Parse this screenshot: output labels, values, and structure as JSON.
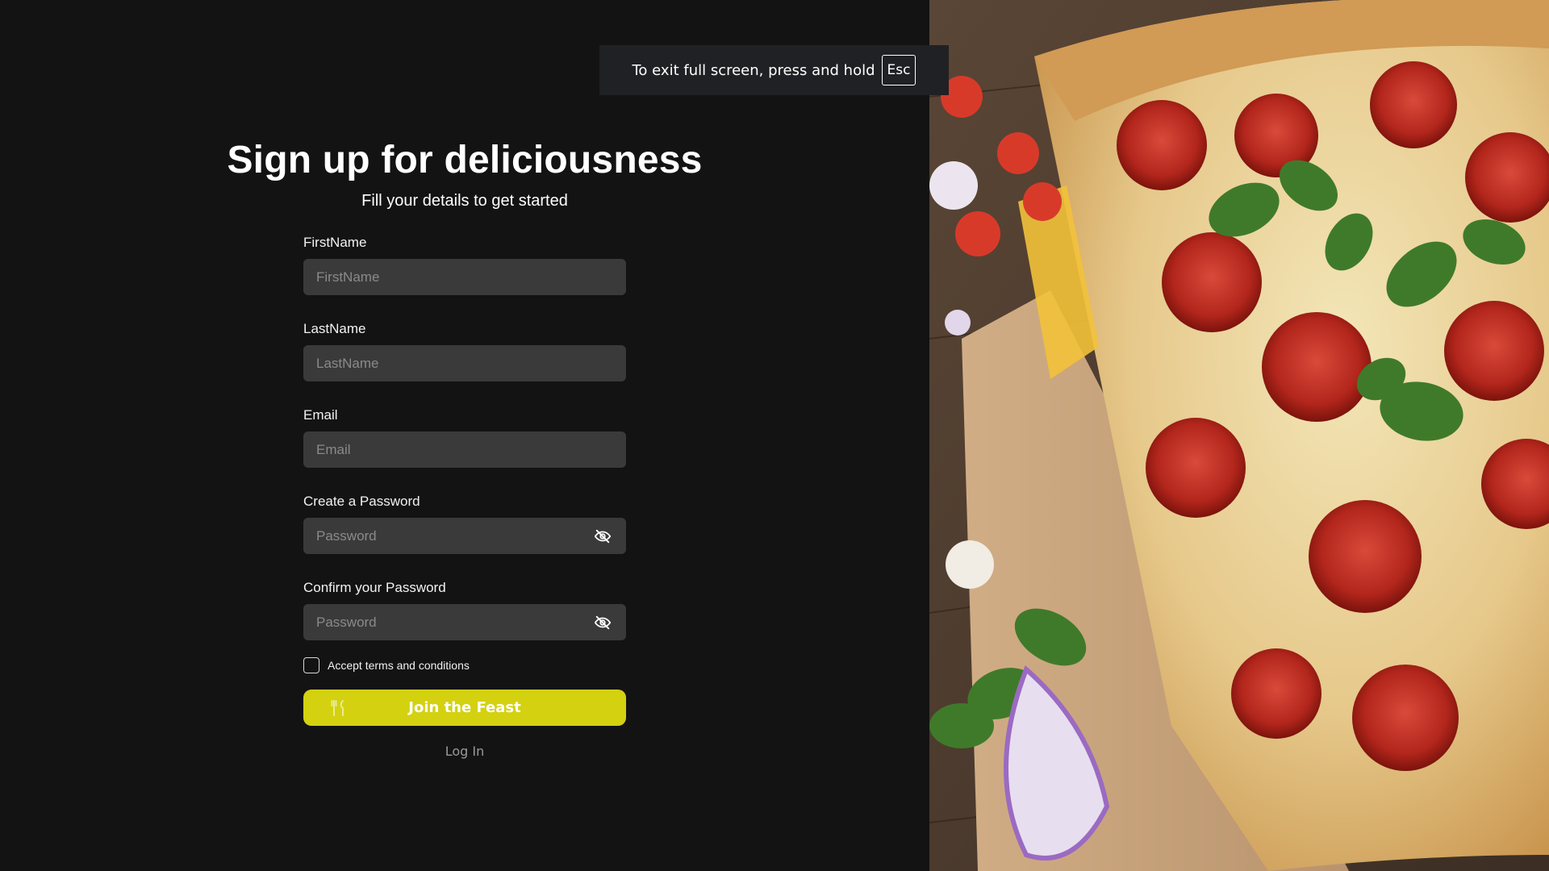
{
  "form": {
    "title": "Sign up for deliciousness",
    "subtitle": "Fill your details to get started",
    "fields": [
      {
        "label": "FirstName",
        "placeholder": "FirstName"
      },
      {
        "label": "LastName",
        "placeholder": "LastName"
      },
      {
        "label": "Email",
        "placeholder": "Email"
      },
      {
        "label": "Create a Password",
        "placeholder": "Password"
      },
      {
        "label": "Confirm your Password",
        "placeholder": "Password"
      }
    ],
    "terms_label": "Accept terms and conditions",
    "submit_label": "Join the Feast",
    "login_label": "Log In"
  },
  "fullscreen_notice": {
    "text": "To exit full screen, press and hold",
    "key": "Esc"
  },
  "icons": {
    "password_toggle": "eye-off-icon",
    "submit": "utensils-icon"
  },
  "colors": {
    "background": "#131313",
    "input_background": "#3a3a3a",
    "accent": "#d4d110"
  }
}
